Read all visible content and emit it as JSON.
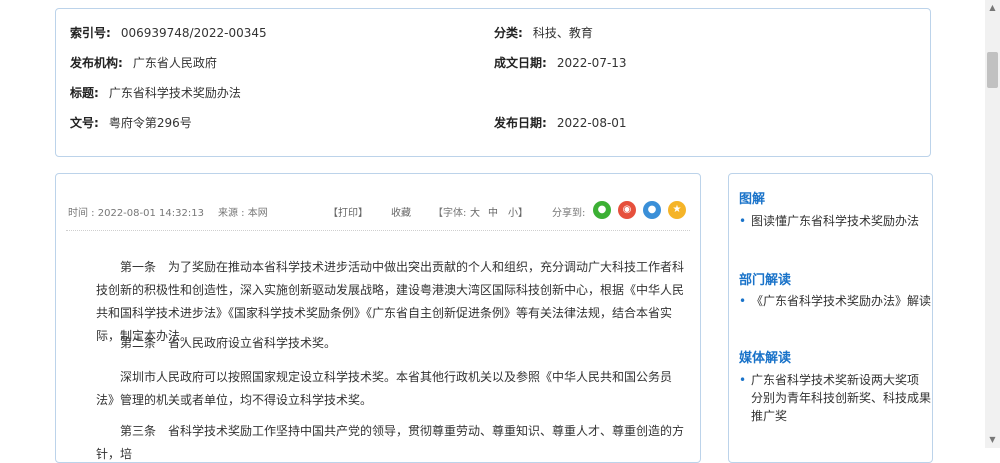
{
  "meta": {
    "index_label": "索引号:",
    "index_value": "006939748/2022-00345",
    "category_label": "分类:",
    "category_value": "科技、教育",
    "issuer_label": "发布机构:",
    "issuer_value": "广东省人民政府",
    "date_made_label": "成文日期:",
    "date_made_value": "2022-07-13",
    "title_label": "标题:",
    "title_value": "广东省科学技术奖励办法",
    "doc_no_label": "文号:",
    "doc_no_value": "粤府令第296号",
    "pub_date_label": "发布日期:",
    "pub_date_value": "2022-08-01"
  },
  "toolbar": {
    "time": "时间 : 2022-08-01 14:32:13",
    "source": "来源 : 本网",
    "print": "【打印】",
    "favorite": "收藏",
    "font_label": "【字体:",
    "font_large": "大",
    "font_medium": "中",
    "font_small": "小】",
    "share_label": "分享到:",
    "share_colors": {
      "wechat": "#3cb034",
      "weibo": "#e6503c",
      "qq": "#3a8fd8",
      "qzone": "#f5b428"
    }
  },
  "article": {
    "p1": "第一条　为了奖励在推动本省科学技术进步活动中做出突出贡献的个人和组织，充分调动广大科技工作者科技创新的积极性和创造性，深入实施创新驱动发展战略，建设粤港澳大湾区国际科技创新中心，根据《中华人民共和国科学技术进步法》《国家科学技术奖励条例》《广东省自主创新促进条例》等有关法律法规，结合本省实际，制定本办法。",
    "p2": "第二条　省人民政府设立省科学技术奖。",
    "p3": "深圳市人民政府可以按照国家规定设立科学技术奖。本省其他行政机关以及参照《中华人民共和国公务员法》管理的机关或者单位，均不得设立科学技术奖。",
    "p4": "第三条　省科学技术奖励工作坚持中国共产党的领导，贯彻尊重劳动、尊重知识、尊重人才、尊重创造的方针，培"
  },
  "sidebar": {
    "graphic_title": "图解",
    "graphic_item": "图读懂广东省科学技术奖励办法",
    "dept_title": "部门解读",
    "dept_item": "《广东省科学技术奖励办法》解读",
    "media_title": "媒体解读",
    "media_item": "广东省科学技术奖新设两大奖项 分别为青年科技创新奖、科技成果推广奖",
    "bullet": "•"
  }
}
